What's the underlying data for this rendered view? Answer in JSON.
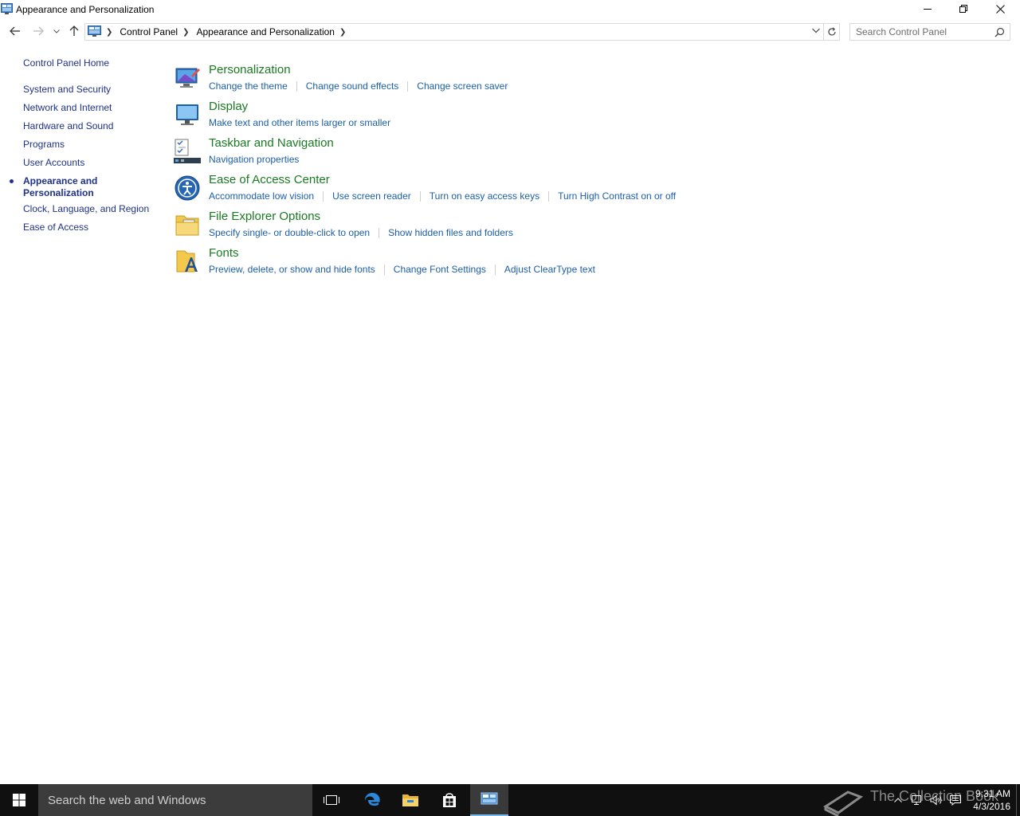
{
  "window": {
    "title": "Appearance and Personalization"
  },
  "address": {
    "crumbs": [
      "Control Panel",
      "Appearance and Personalization"
    ],
    "search_placeholder": "Search Control Panel"
  },
  "leftnav": {
    "home": "Control Panel Home",
    "items": [
      {
        "label": "System and Security"
      },
      {
        "label": "Network and Internet"
      },
      {
        "label": "Hardware and Sound"
      },
      {
        "label": "Programs"
      },
      {
        "label": "User Accounts"
      },
      {
        "label": "Appearance and Personalization",
        "current": true
      },
      {
        "label": "Clock, Language, and Region"
      },
      {
        "label": "Ease of Access"
      }
    ]
  },
  "categories": [
    {
      "title": "Personalization",
      "icon": "personalization-icon",
      "links": [
        "Change the theme",
        "Change sound effects",
        "Change screen saver"
      ]
    },
    {
      "title": "Display",
      "icon": "display-icon",
      "links": [
        "Make text and other items larger or smaller"
      ]
    },
    {
      "title": "Taskbar and Navigation",
      "icon": "taskbar-icon",
      "links": [
        "Navigation properties"
      ]
    },
    {
      "title": "Ease of Access Center",
      "icon": "ease-of-access-icon",
      "links": [
        "Accommodate low vision",
        "Use screen reader",
        "Turn on easy access keys",
        "Turn High Contrast on or off"
      ]
    },
    {
      "title": "File Explorer Options",
      "icon": "folder-options-icon",
      "links": [
        "Specify single- or double-click to open",
        "Show hidden files and folders"
      ]
    },
    {
      "title": "Fonts",
      "icon": "fonts-icon",
      "links": [
        "Preview, delete, or show and hide fonts",
        "Change Font Settings",
        "Adjust ClearType text"
      ]
    }
  ],
  "taskbar": {
    "search_text": "Search the web and Windows",
    "watermark": "The Collection Book",
    "time": "9:31 AM",
    "date": "4/3/2016"
  },
  "colors": {
    "heading_green": "#1a7a22",
    "link_blue": "#1c5ea8",
    "nav_blue": "#1e3287",
    "taskbar": "#101010"
  }
}
